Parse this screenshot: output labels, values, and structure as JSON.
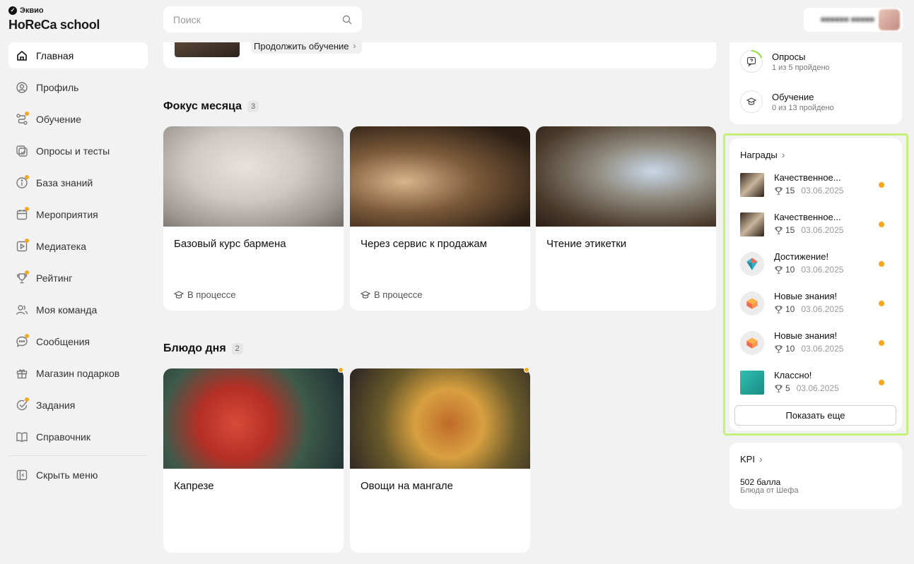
{
  "brand": {
    "small": "Эквио",
    "title": "HoReCa school"
  },
  "nav": {
    "items": [
      {
        "label": "Главная",
        "icon": "home-icon",
        "active": true,
        "dot": false
      },
      {
        "label": "Профиль",
        "icon": "profile-icon",
        "active": false,
        "dot": false
      },
      {
        "label": "Обучение",
        "icon": "learning-icon",
        "active": false,
        "dot": true
      },
      {
        "label": "Опросы и тесты",
        "icon": "surveys-icon",
        "active": false,
        "dot": false
      },
      {
        "label": "База знаний",
        "icon": "info-icon",
        "active": false,
        "dot": true
      },
      {
        "label": "Мероприятия",
        "icon": "calendar-icon",
        "active": false,
        "dot": true
      },
      {
        "label": "Медиатека",
        "icon": "media-icon",
        "active": false,
        "dot": true
      },
      {
        "label": "Рейтинг",
        "icon": "trophy-icon",
        "active": false,
        "dot": true
      },
      {
        "label": "Моя команда",
        "icon": "team-icon",
        "active": false,
        "dot": false
      },
      {
        "label": "Сообщения",
        "icon": "chat-icon",
        "active": false,
        "dot": true
      },
      {
        "label": "Магазин подарков",
        "icon": "gift-icon",
        "active": false,
        "dot": false
      },
      {
        "label": "Задания",
        "icon": "tasks-icon",
        "active": false,
        "dot": true
      },
      {
        "label": "Справочник",
        "icon": "book-icon",
        "active": false,
        "dot": false
      }
    ],
    "hide_menu": "Скрыть меню"
  },
  "search": {
    "placeholder": "Поиск"
  },
  "continue": {
    "button": "Продолжить обучение"
  },
  "focus": {
    "title": "Фокус месяца",
    "count": "3",
    "cards": [
      {
        "title": "Базовый курс бармена",
        "status": "В процессе"
      },
      {
        "title": "Через сервис к продажам",
        "status": "В процессе"
      },
      {
        "title": "Чтение этикетки",
        "status": ""
      }
    ]
  },
  "dish": {
    "title": "Блюдо дня",
    "count": "2",
    "cards": [
      {
        "title": "Капрезе"
      },
      {
        "title": "Овощи на мангале"
      }
    ]
  },
  "stats": {
    "surveys": {
      "title": "Опросы",
      "sub": "1 из 5 пройдено",
      "progress": 0.2
    },
    "learning": {
      "title": "Обучение",
      "sub": "0 из 13 пройдено",
      "progress": 0
    }
  },
  "rewards": {
    "title": "Награды",
    "items": [
      {
        "name": "Качественное...",
        "points": "15",
        "date": "03.06.2025",
        "thumb": "photo"
      },
      {
        "name": "Качественное...",
        "points": "15",
        "date": "03.06.2025",
        "thumb": "photo"
      },
      {
        "name": "Достижение!",
        "points": "10",
        "date": "03.06.2025",
        "thumb": "achievement"
      },
      {
        "name": "Новые знания!",
        "points": "10",
        "date": "03.06.2025",
        "thumb": "knowledge"
      },
      {
        "name": "Новые знания!",
        "points": "10",
        "date": "03.06.2025",
        "thumb": "knowledge"
      },
      {
        "name": "Классно!",
        "points": "5",
        "date": "03.06.2025",
        "thumb": "teal"
      }
    ],
    "show_more": "Показать еще"
  },
  "kpi": {
    "title": "KPI",
    "value": "502 балла",
    "sub": "Блюда от Шефа"
  },
  "colors": {
    "accent_dot": "#f5a623",
    "highlight_border": "#c5f07a",
    "background": "#f2f2f2"
  }
}
